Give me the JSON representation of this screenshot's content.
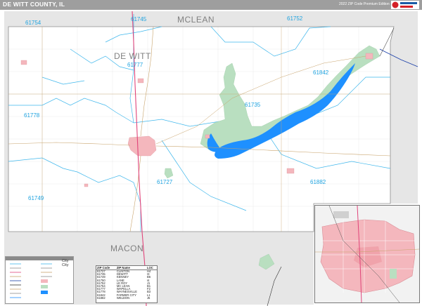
{
  "header": {
    "title": "DE WITT COUNTY, IL",
    "edition": "2022 ZIP Code Premium Edition"
  },
  "counties": {
    "north": "MCLEAN",
    "center": "DE WITT",
    "south": "MACON"
  },
  "zip_labels": [
    "61754",
    "61745",
    "61752",
    "61777",
    "61842",
    "61735",
    "61778",
    "61727",
    "61882",
    "61749"
  ],
  "legend": {
    "city_labels": [
      "City",
      "City"
    ]
  },
  "zip_table": {
    "headers": [
      "ZIP Code",
      "ZIP Name",
      "LOC"
    ],
    "rows": [
      [
        "61727",
        "CLINTON",
        "H4"
      ],
      [
        "61735",
        "DEWITT",
        "I3"
      ],
      [
        "61749",
        "KENNEY",
        "B6"
      ],
      [
        "61750",
        "LANE",
        "I4"
      ],
      [
        "61752",
        "LE ROY",
        "J1"
      ],
      [
        "61754",
        "MC LEAN",
        "B1"
      ],
      [
        "61777",
        "WAPELLA",
        "F2"
      ],
      [
        "61778",
        "WAYNESVILLE",
        "B3"
      ],
      [
        "61842",
        "FARMER CITY",
        "L1"
      ],
      [
        "61882",
        "WELDON",
        "J5"
      ]
    ]
  },
  "colors": {
    "zip_label": "#1fa3e0",
    "zip_boundary": "#3fb7ec",
    "county_label": "#808080",
    "city_fill": "#f4b7bd",
    "park_fill": "#b9dfc0",
    "water_fill": "#1e90ff",
    "highway": "#e0447a",
    "outside_county": "#e6e6e6",
    "header_bar": "#9e9e9e"
  }
}
